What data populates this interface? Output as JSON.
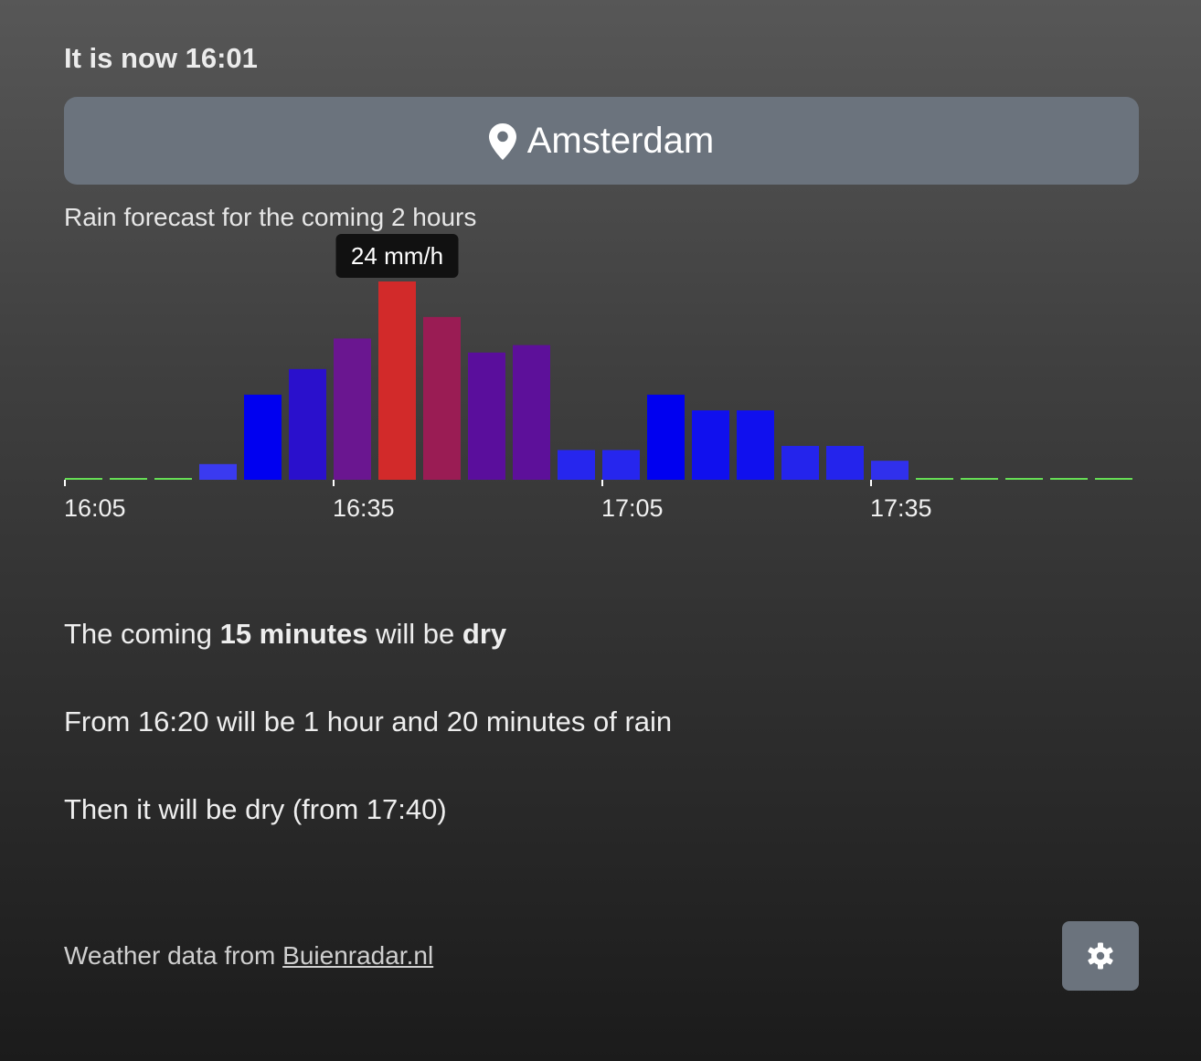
{
  "header": {
    "now_prefix": "It is now",
    "now_time": "16:01"
  },
  "location": {
    "name": "Amsterdam",
    "icon": "map-pin-icon"
  },
  "forecast_label": "Rain forecast for the coming 2 hours",
  "tooltip": {
    "text": "24 mm/h"
  },
  "chart_data": {
    "type": "bar",
    "title": "",
    "xlabel": "",
    "ylabel": "",
    "ylim": [
      0,
      24
    ],
    "categories": [
      "16:05",
      "16:10",
      "16:15",
      "16:20",
      "16:25",
      "16:30",
      "16:35",
      "16:40",
      "16:45",
      "16:50",
      "16:55",
      "17:00",
      "17:05",
      "17:10",
      "17:15",
      "17:20",
      "17:25",
      "17:30",
      "17:35",
      "17:40",
      "17:45",
      "17:50",
      "17:55",
      "18:00"
    ],
    "values": [
      0,
      0,
      0,
      1.9,
      10.3,
      13.4,
      17.1,
      24,
      19.7,
      15.4,
      16.3,
      3.6,
      3.6,
      10.3,
      8.4,
      8.4,
      4.1,
      4.1,
      2.3,
      0,
      0,
      0,
      0,
      0
    ],
    "colors": [
      "#66dd55",
      "#66dd55",
      "#66dd55",
      "#3a3af0",
      "#0000f0",
      "#2a10cc",
      "#6a1690",
      "#d22a2a",
      "#9a1c54",
      "#5a0e9c",
      "#5d109a",
      "#2626ee",
      "#2626ee",
      "#0000f0",
      "#1010ee",
      "#1010ee",
      "#2424ec",
      "#2424ec",
      "#3030ec",
      "#66dd55",
      "#66dd55",
      "#66dd55",
      "#66dd55",
      "#66dd55"
    ],
    "tick_labels": [
      "16:05",
      "16:35",
      "17:05",
      "17:35"
    ],
    "tick_indices": [
      0,
      6,
      12,
      18
    ],
    "highlighted_index": 7
  },
  "summary": {
    "line1_prefix": "The coming ",
    "line1_duration": "15 minutes",
    "line1_middle": " will be ",
    "line1_state": "dry",
    "line2": "From 16:20 will be 1 hour and 20 minutes of rain",
    "line3": "Then it will be dry (from 17:40)"
  },
  "footer": {
    "prefix": "Weather data from ",
    "link_text": "Buienradar.nl"
  },
  "settings": {
    "icon": "gear-icon"
  }
}
